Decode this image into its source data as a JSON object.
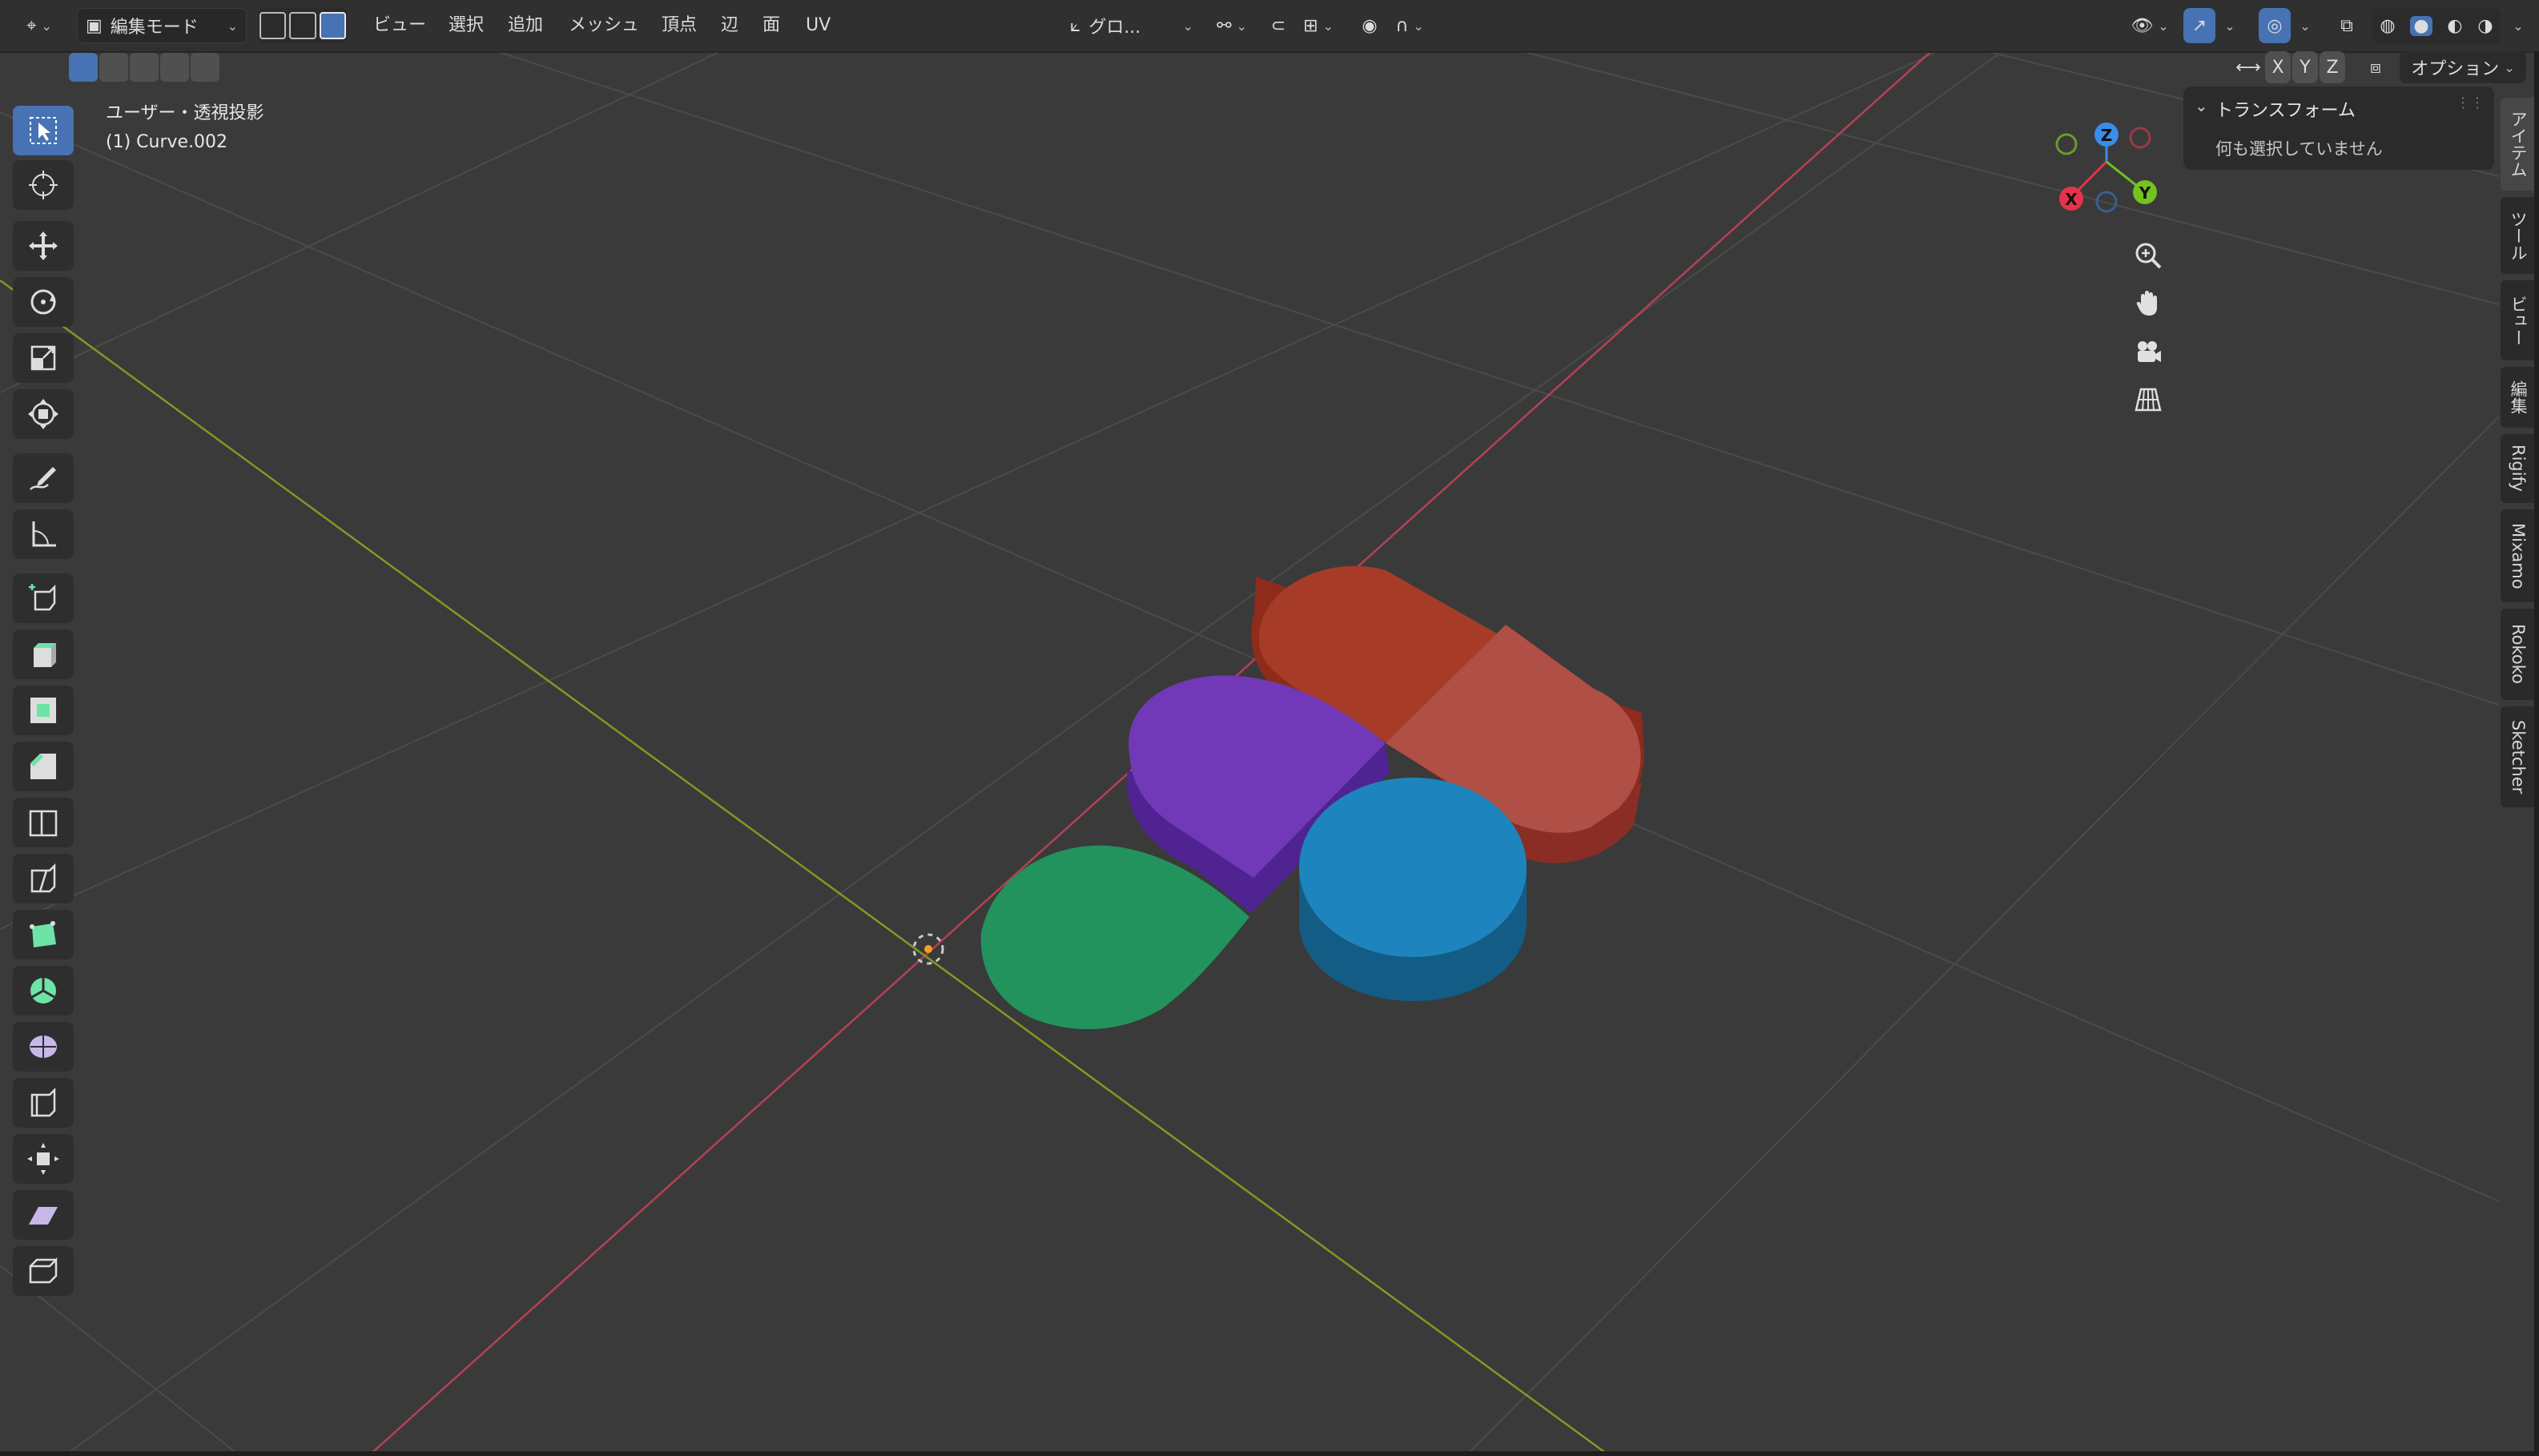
{
  "header": {
    "editor_type_icon": "mesh-edit-icon",
    "mode_label": "編集モード",
    "menus": [
      "ビュー",
      "選択",
      "追加",
      "メッシュ",
      "頂点",
      "辺",
      "面",
      "UV"
    ],
    "transform_orientation": "グロ...",
    "axis_labels": [
      "X",
      "Y",
      "Z"
    ],
    "options_label": "オプション"
  },
  "viewport": {
    "view_name": "ユーザー・透視投影",
    "object_name": "(1) Curve.002",
    "grid_color": "#4a4a4a",
    "x_axis_color": "#c94751",
    "y_axis_color": "#87a82a",
    "shapes": {
      "red_capsule": "#a63c27",
      "red_capsule_light": "#b04f46",
      "purple_drop": "#7138b8",
      "green_drop": "#23935e",
      "blue_cylinder": "#1e84bd"
    }
  },
  "gizmo": {
    "axes": [
      "X",
      "Y",
      "Z"
    ],
    "x_color": "#e5334a",
    "y_color": "#74c21f",
    "z_color": "#3b8ee8"
  },
  "npanel": {
    "title": "トランスフォーム",
    "message": "何も選択していません"
  },
  "side_tabs": [
    "アイテム",
    "ツール",
    "ビュー",
    "編集",
    "Rigify",
    "Mixamo",
    "Rokoko",
    "Sketcher"
  ]
}
